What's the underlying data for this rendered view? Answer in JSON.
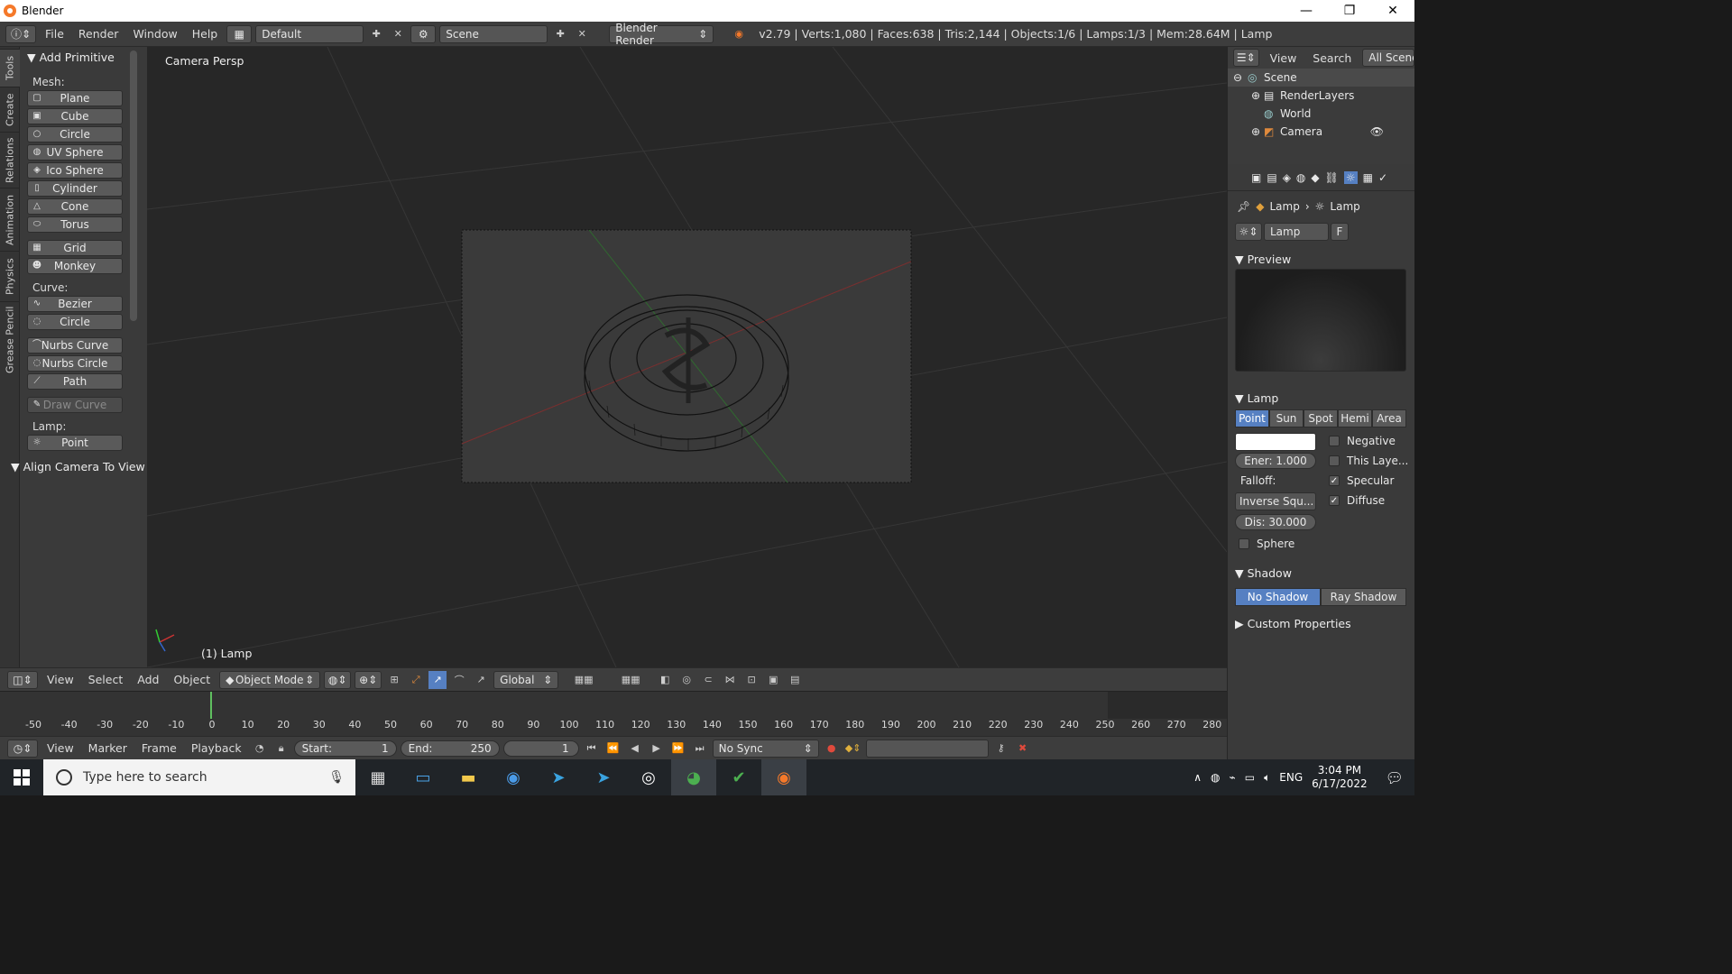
{
  "window": {
    "title": "Blender",
    "minimize": "—",
    "maximize": "❐",
    "close": "✕"
  },
  "header": {
    "menus": [
      "File",
      "Render",
      "Window",
      "Help"
    ],
    "layout": "Default",
    "scene": "Scene",
    "engine": "Blender Render",
    "stats": "v2.79 | Verts:1,080 | Faces:638 | Tris:2,144 | Objects:1/6 | Lamps:1/3 | Mem:28.64M | Lamp"
  },
  "left_tabs": [
    "Tools",
    "Create",
    "Relations",
    "Animation",
    "Physics",
    "Grease Pencil"
  ],
  "toolshelf": {
    "panel_title": "Add Primitive",
    "mesh_label": "Mesh:",
    "mesh_items": [
      "Plane",
      "Cube",
      "Circle",
      "UV Sphere",
      "Ico Sphere",
      "Cylinder",
      "Cone",
      "Torus"
    ],
    "mesh_items2": [
      "Grid",
      "Monkey"
    ],
    "curve_label": "Curve:",
    "curve_items": [
      "Bezier",
      "Circle"
    ],
    "curve_items2": [
      "Nurbs Curve",
      "Nurbs Circle",
      "Path"
    ],
    "draw_curve": "Draw Curve",
    "lamp_label": "Lamp:",
    "lamp_items": [
      "Point"
    ],
    "align_panel": "Align Camera To View"
  },
  "viewport": {
    "label": "Camera Persp",
    "object": "(1) Lamp"
  },
  "vp_header": {
    "menus": [
      "View",
      "Select",
      "Add",
      "Object"
    ],
    "mode": "Object Mode",
    "orientation": "Global"
  },
  "timeline": {
    "ticks": [
      "-50",
      "-40",
      "-30",
      "-20",
      "-10",
      "0",
      "10",
      "20",
      "30",
      "40",
      "50",
      "60",
      "70",
      "80",
      "90",
      "100",
      "110",
      "120",
      "130",
      "140",
      "150",
      "160",
      "170",
      "180",
      "190",
      "200",
      "210",
      "220",
      "230",
      "240",
      "250",
      "260",
      "270",
      "280"
    ],
    "menus": [
      "View",
      "Marker",
      "Frame",
      "Playback"
    ],
    "start": "Start:",
    "start_val": "1",
    "end": "End:",
    "end_val": "250",
    "current": "1",
    "sync": "No Sync"
  },
  "outliner": {
    "menus": [
      "View",
      "Search",
      "All Scenes"
    ],
    "rows": [
      "Scene",
      "RenderLayers",
      "World",
      "Camera"
    ]
  },
  "properties": {
    "breadcrumb": [
      "Lamp",
      "Lamp"
    ],
    "datablock": "Lamp",
    "fake": "F",
    "preview": "Preview",
    "lamp_panel": "Lamp",
    "lamp_types": [
      "Point",
      "Sun",
      "Spot",
      "Hemi",
      "Area"
    ],
    "energy": "Ener: 1.000",
    "falloff_label": "Falloff:",
    "falloff": "Inverse Squ...",
    "distance": "Dis: 30.000",
    "negative": "Negative",
    "this_layer": "This Laye...",
    "specular": "Specular",
    "diffuse": "Diffuse",
    "sphere": "Sphere",
    "shadow_panel": "Shadow",
    "shadow_types": [
      "No Shadow",
      "Ray Shadow"
    ],
    "custom": "Custom Properties"
  },
  "taskbar": {
    "search_placeholder": "Type here to search",
    "lang": "ENG",
    "time": "3:04 PM",
    "date": "6/17/2022"
  }
}
